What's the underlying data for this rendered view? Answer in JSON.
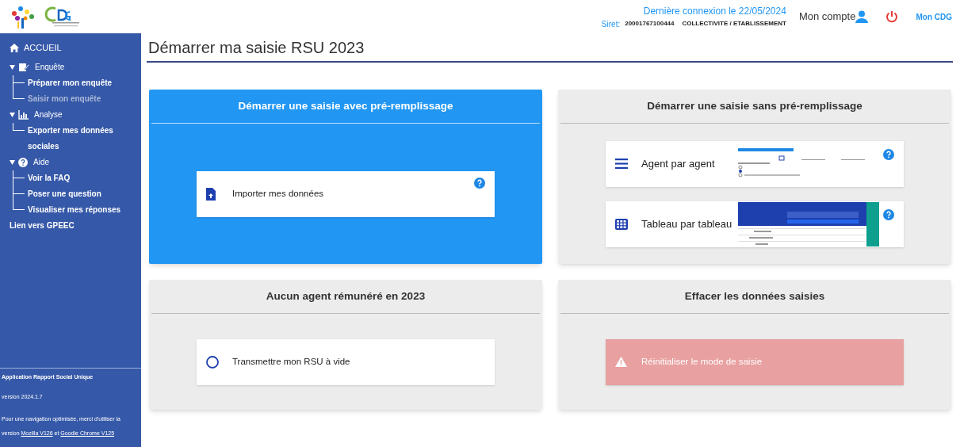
{
  "header": {
    "last_login": "Dernière connexion le 22/05/2024",
    "siret_label": "Siret:",
    "siret": "20001767100444",
    "entity": "COLLECTIVITE / ETABLISSEMENT",
    "account": "Mon compte",
    "cdg_link": "Mon CDG"
  },
  "sidebar": {
    "home": "ACCUEIL",
    "items": [
      {
        "label": "Enquête",
        "kind": "survey",
        "expanded": true,
        "children": [
          {
            "label": "Préparer mon enquête",
            "disabled": false
          },
          {
            "label": "Saisir mon enquête",
            "disabled": true
          }
        ]
      },
      {
        "label": "Analyse",
        "kind": "chart",
        "expanded": true,
        "children": [
          {
            "label": "Exporter mes données sociales",
            "disabled": false
          }
        ]
      },
      {
        "label": "Aide",
        "kind": "help",
        "expanded": true,
        "children": [
          {
            "label": "Voir la FAQ",
            "disabled": false
          },
          {
            "label": "Poser une question",
            "disabled": false
          },
          {
            "label": "Visualiser mes réponses",
            "disabled": false
          }
        ]
      }
    ],
    "extra_link": "Lien vers GPEEC",
    "footer": {
      "app_name": "Application Rapport Social Unique",
      "version": "version 2024.1.7",
      "note_start": "Pour une navigation optimisée, merci d'utiliser la version",
      "links": [
        "Mozilla V126",
        "Goodle Chrome V125"
      ],
      "note_join": "et"
    }
  },
  "page_title": "Démarrer ma saisie RSU 2023",
  "cards": [
    {
      "title": "Démarrer une saisie avec pré-remplissage",
      "highlighted": true,
      "options": [
        {
          "kind": "import",
          "label": "Importer mes données",
          "help": true
        }
      ]
    },
    {
      "title": "Démarrer une saisie sans pré-remplissage",
      "highlighted": false,
      "options": [
        {
          "kind": "form",
          "label": "Agent par agent",
          "help": true
        },
        {
          "kind": "table",
          "label": "Tableau par tableau",
          "help": true
        }
      ]
    },
    {
      "title": "Aucun agent rémunéré en 2023",
      "highlighted": false,
      "options": [
        {
          "kind": "radio",
          "label": "Transmettre mon RSU à vide",
          "help": false
        }
      ]
    },
    {
      "title": "Effacer les données saisies",
      "highlighted": false,
      "options": [
        {
          "kind": "danger",
          "label": "Réinitialiser le mode de saisie",
          "help": false
        }
      ]
    }
  ]
}
